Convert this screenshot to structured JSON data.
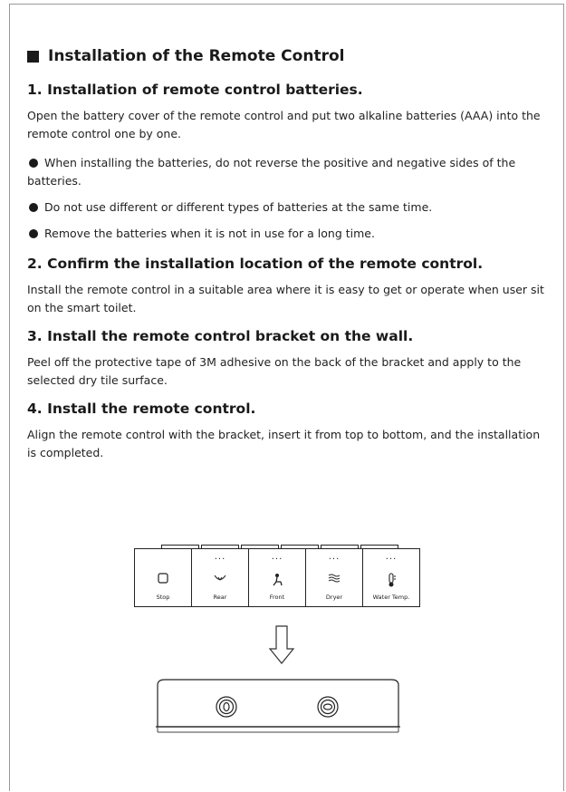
{
  "title": "Installation of the Remote Control",
  "sections": [
    {
      "heading": "1. Installation of remote control batteries.",
      "text": "Open the battery cover of the remote control and put two alkaline batteries (AAA) into the remote control one by one.",
      "bullets": [
        "When installing the batteries, do not reverse the positive and negative sides of the batteries.",
        "Do not use different or different types of batteries at the same time.",
        "Remove the batteries when it is not in use for a long time."
      ]
    },
    {
      "heading": "2. Confirm the installation location of the remote control.",
      "text": "Install the remote control in a suitable area where it is easy to get or operate when user sit on the smart toilet."
    },
    {
      "heading": "3. Install the remote control bracket on the wall.",
      "text": "Peel off the protective tape of 3M adhesive on the back of the bracket and apply to the selected dry tile surface."
    },
    {
      "heading": "4. Install the remote control.",
      "text": "Align the remote control with the bracket, insert it from top to bottom, and the installation is completed."
    }
  ],
  "remote": {
    "buttons": [
      {
        "label": "Stop",
        "dots": "",
        "icon": "stop-icon"
      },
      {
        "label": "Rear",
        "dots": "···",
        "icon": "rear-wash-icon"
      },
      {
        "label": "Front",
        "dots": "···",
        "icon": "front-wash-icon"
      },
      {
        "label": "Dryer",
        "dots": "···",
        "icon": "dryer-icon"
      },
      {
        "label": "Water Temp.",
        "dots": "···",
        "icon": "thermometer-icon"
      }
    ]
  },
  "bracket": {
    "screws": [
      "screw-hole-icon",
      "screw-hole-icon"
    ]
  }
}
